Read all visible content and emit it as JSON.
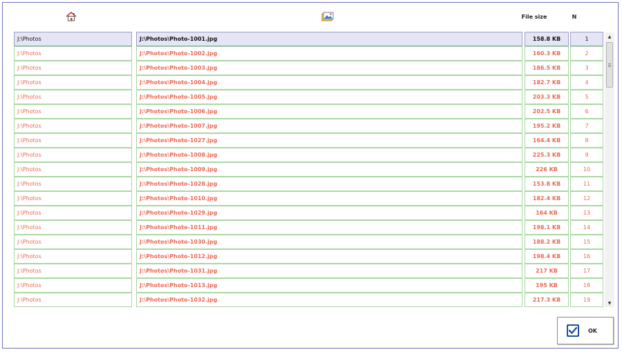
{
  "header": {
    "folder_icon": "home-icon",
    "file_icon": "picture-icon",
    "size_label": "File size",
    "n_label": "N"
  },
  "rows": [
    {
      "folder": "J:\\Photos",
      "file": "J:\\Photos\\Photo-1001.jpg",
      "size": "158.8 KB",
      "n": "1",
      "selected": true
    },
    {
      "folder": "J:\\Photos",
      "file": "J:\\Photos\\Photo-1002.jpg",
      "size": "160.3 KB",
      "n": "2"
    },
    {
      "folder": "J:\\Photos",
      "file": "J:\\Photos\\Photo-1003.jpg",
      "size": "186.5 KB",
      "n": "3"
    },
    {
      "folder": "J:\\Photos",
      "file": "J:\\Photos\\Photo-1004.jpg",
      "size": "182.7 KB",
      "n": "4"
    },
    {
      "folder": "J:\\Photos",
      "file": "J:\\Photos\\Photo-1005.jpg",
      "size": "203.3 KB",
      "n": "5"
    },
    {
      "folder": "J:\\Photos",
      "file": "J:\\Photos\\Photo-1006.jpg",
      "size": "202.5 KB",
      "n": "6"
    },
    {
      "folder": "J:\\Photos",
      "file": "J:\\Photos\\Photo-1007.jpg",
      "size": "195.2 KB",
      "n": "7"
    },
    {
      "folder": "J:\\Photos",
      "file": "J:\\Photos\\Photo-1027.jpg",
      "size": "164.4 KB",
      "n": "8"
    },
    {
      "folder": "J:\\Photos",
      "file": "J:\\Photos\\Photo-1008.jpg",
      "size": "225.3 KB",
      "n": "9"
    },
    {
      "folder": "J:\\Photos",
      "file": "J:\\Photos\\Photo-1009.jpg",
      "size": "226 KB",
      "n": "10"
    },
    {
      "folder": "J:\\Photos",
      "file": "J:\\Photos\\Photo-1028.jpg",
      "size": "153.8 KB",
      "n": "11"
    },
    {
      "folder": "J:\\Photos",
      "file": "J:\\Photos\\Photo-1010.jpg",
      "size": "182.4 KB",
      "n": "12"
    },
    {
      "folder": "J:\\Photos",
      "file": "J:\\Photos\\Photo-1029.jpg",
      "size": "164 KB",
      "n": "13"
    },
    {
      "folder": "J:\\Photos",
      "file": "J:\\Photos\\Photo-1011.jpg",
      "size": "198.1 KB",
      "n": "14"
    },
    {
      "folder": "J:\\Photos",
      "file": "J:\\Photos\\Photo-1030.jpg",
      "size": "188.2 KB",
      "n": "15"
    },
    {
      "folder": "J:\\Photos",
      "file": "J:\\Photos\\Photo-1012.jpg",
      "size": "198.4 KB",
      "n": "16"
    },
    {
      "folder": "J:\\Photos",
      "file": "J:\\Photos\\Photo-1031.jpg",
      "size": "217 KB",
      "n": "17"
    },
    {
      "folder": "J:\\Photos",
      "file": "J:\\Photos\\Photo-1013.jpg",
      "size": "195 KB",
      "n": "18"
    },
    {
      "folder": "J:\\Photos",
      "file": "J:\\Photos\\Photo-1032.jpg",
      "size": "217.3 KB",
      "n": "19"
    }
  ],
  "scrollbar": {
    "up_icon": "arrow-up-icon",
    "down_icon": "arrow-down-icon",
    "position": 0.0
  },
  "ok_button": {
    "label": "OK",
    "icon": "checkbox-checked-icon"
  },
  "colors": {
    "row_text": "#e96a57",
    "selected_bg": "#e5e5f5",
    "grid": "#a9d7a3",
    "frame": "#6f6fb8",
    "check": "#1f4f9c"
  }
}
